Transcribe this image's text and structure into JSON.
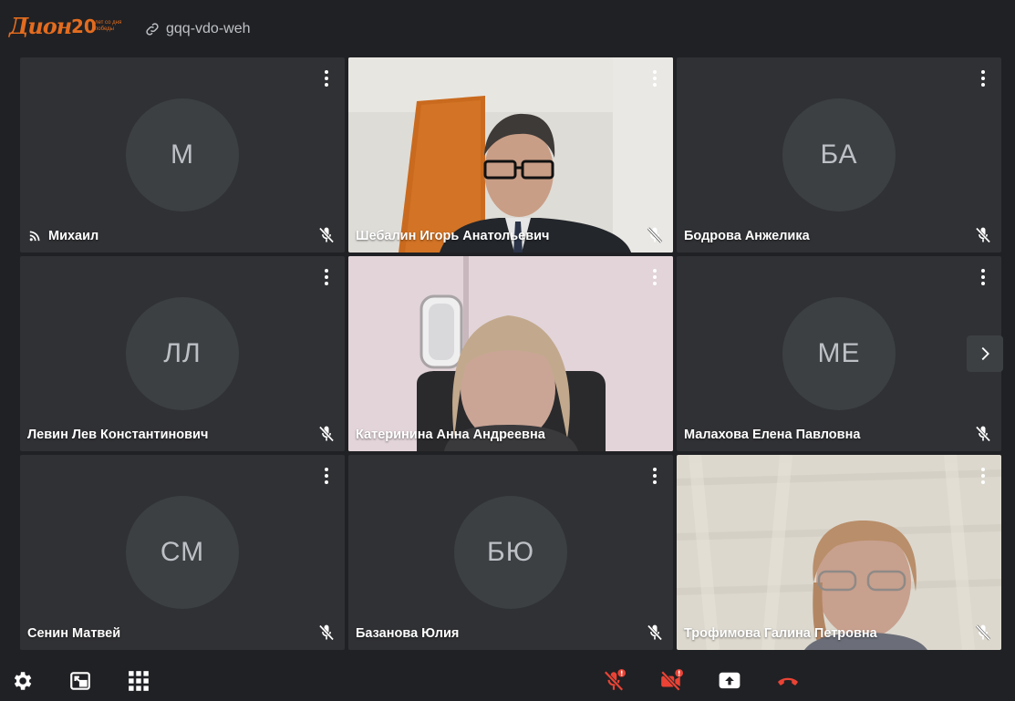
{
  "logo": {
    "brand": "Дион",
    "number": "20",
    "tagline": "лет со дня победы"
  },
  "meeting": {
    "code": "gqq-vdo-weh"
  },
  "participants": [
    {
      "name": "Михаил",
      "initials": "М",
      "video": false,
      "muted": true,
      "speaking": false,
      "icon": "broadcast-icon"
    },
    {
      "name": "Шебалин Игорь Анатольевич",
      "initials": "",
      "video": true,
      "muted": true,
      "speaking": false
    },
    {
      "name": "Бодрова Анжелика",
      "initials": "БА",
      "video": false,
      "muted": true,
      "speaking": false
    },
    {
      "name": "Левин Лев Константинович",
      "initials": "ЛЛ",
      "video": false,
      "muted": true,
      "speaking": false
    },
    {
      "name": "Катеринина Анна Андреевна",
      "initials": "",
      "video": true,
      "muted": false,
      "speaking": true
    },
    {
      "name": "Малахова Елена Павловна",
      "initials": "МЕ",
      "video": false,
      "muted": true,
      "speaking": false
    },
    {
      "name": "Сенин Матвей",
      "initials": "СМ",
      "video": false,
      "muted": true,
      "speaking": false
    },
    {
      "name": "Базанова Юлия",
      "initials": "БЮ",
      "video": false,
      "muted": true,
      "speaking": false
    },
    {
      "name": "Трофимова Галина Петровна",
      "initials": "",
      "video": true,
      "muted": true,
      "speaking": false
    }
  ],
  "toolbar": {
    "left": [
      "settings-icon",
      "pip-icon",
      "apps-grid-icon"
    ],
    "center": [
      "mic-off-warning-icon",
      "camera-off-warning-icon",
      "share-screen-icon",
      "end-call-icon"
    ]
  },
  "colors": {
    "background": "#202124",
    "tile": "#303134",
    "avatar": "#3c4043",
    "speaking_border": "#34a853",
    "alert_red": "#ea4335",
    "accent_orange": "#e36c1f"
  }
}
